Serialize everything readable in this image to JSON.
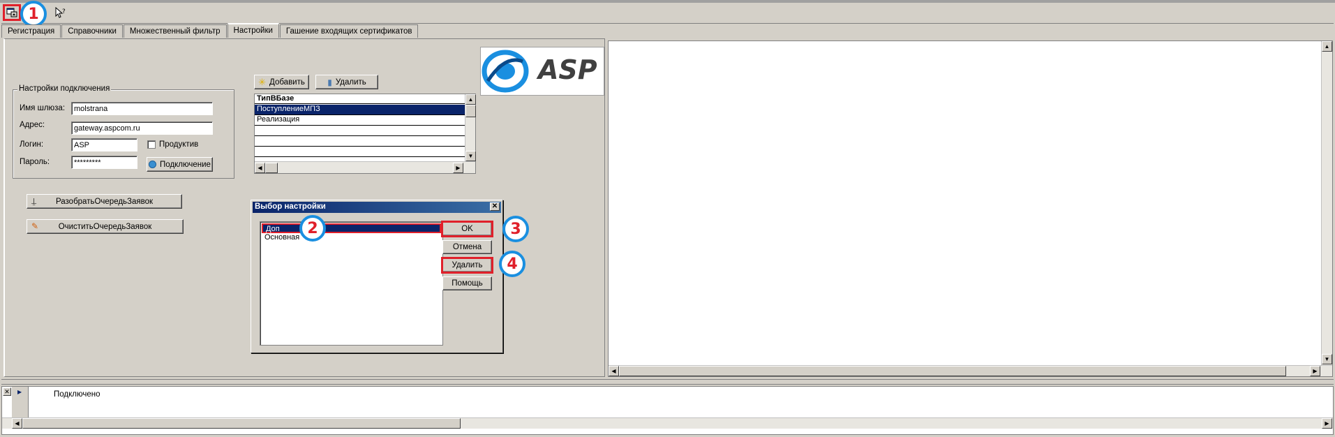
{
  "toolbar": {
    "settings_icon": "settings-window-icon",
    "help_icon": "context-help-icon"
  },
  "tabs": [
    {
      "label": "Регистрация"
    },
    {
      "label": "Справочники"
    },
    {
      "label": "Множественный фильтр"
    },
    {
      "label": "Настройки"
    },
    {
      "label": "Гашение входящих сертификатов"
    }
  ],
  "connection": {
    "legend": "Настройки подключения",
    "gateway_label": "Имя шлюза:",
    "gateway_value": "molstrana",
    "address_label": "Адрес:",
    "address_value": "gateway.aspcom.ru",
    "login_label": "Логин:",
    "login_value": "ASP",
    "password_label": "Пароль:",
    "password_value": "*********",
    "productive_label": "Продуктив",
    "connect_label": "Подключение"
  },
  "queue": {
    "parse_label": "РазобратьОчередьЗаявок",
    "clear_label": "ОчиститьОчередьЗаявок"
  },
  "types": {
    "add_label": "Добавить",
    "delete_label": "Удалить",
    "header": "ТипВБазе",
    "rows": [
      "ПоступлениеМПЗ",
      "Реализация",
      "",
      "",
      ""
    ]
  },
  "logo": {
    "text": "ASP"
  },
  "dialog": {
    "title": "Выбор настройки",
    "items": [
      "Доп",
      "Основная"
    ],
    "ok_label": "OK",
    "cancel_label": "Отмена",
    "delete_label": "Удалить",
    "help_label": "Помощь"
  },
  "annotations": [
    "1",
    "2",
    "3",
    "4"
  ],
  "status": {
    "message": "Подключено"
  },
  "colors": {
    "highlight": "#0a246a",
    "callout_red": "#e0202a",
    "callout_blue": "#1a8fe0"
  }
}
